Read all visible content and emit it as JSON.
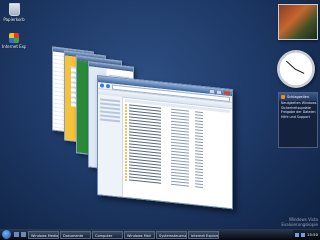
{
  "desktop": {
    "icons": [
      {
        "label": "Papierkorb",
        "icon": "recycle-bin-icon"
      },
      {
        "label": "Internet Explorer",
        "icon": "internet-explorer-icon"
      }
    ]
  },
  "gadgets": {
    "clock": {
      "hour": 3,
      "minute": 52
    },
    "feed": {
      "title": "Schlagzeilen",
      "items": [
        "Neuigkeiten Windows",
        "Sicherheitsupdate",
        "Freigabe der Dateien",
        "Hilfe und Support"
      ]
    }
  },
  "watermark": {
    "line1": "Windows Vista",
    "line2": "Evaluierungskopie"
  },
  "taskbar": {
    "buttons": [
      "Windows Media",
      "Dokumente",
      "Computer",
      "Windows Mail",
      "Systemsteuerung",
      "Internet Explorer"
    ],
    "time": "15:50"
  }
}
